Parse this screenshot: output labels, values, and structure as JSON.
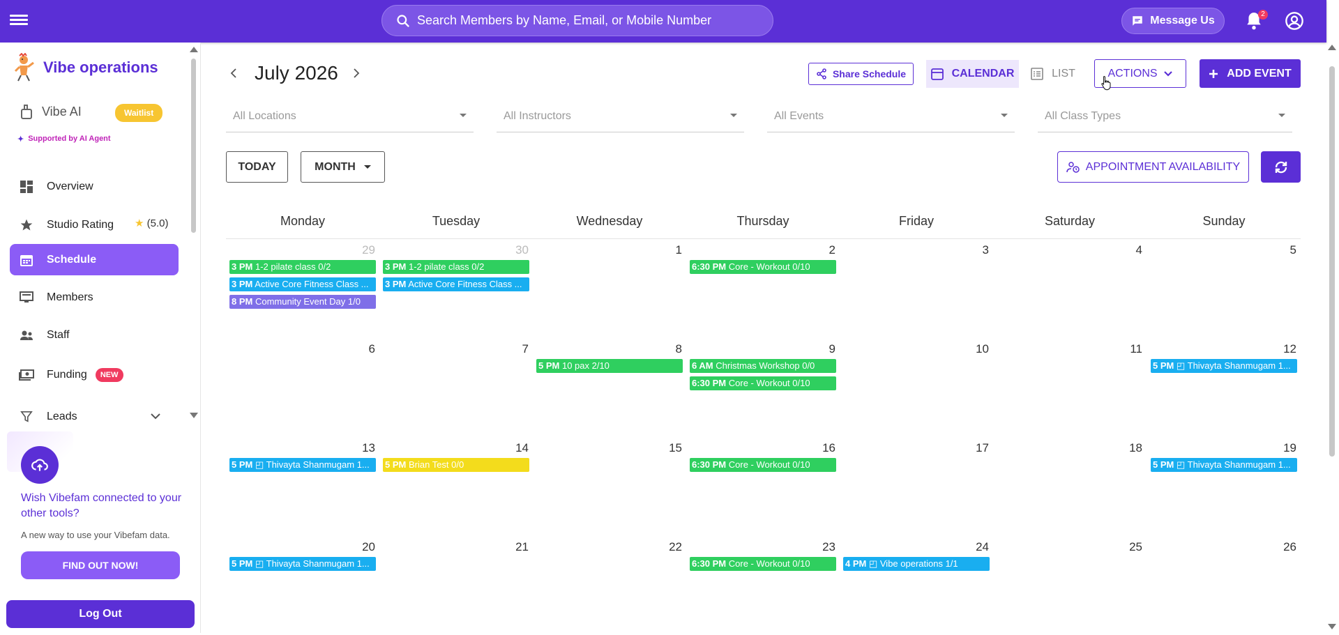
{
  "topbar": {
    "search_placeholder": "Search Members by Name, Email, or Mobile Number",
    "message_label": "Message Us",
    "notification_count": "2"
  },
  "sidebar": {
    "brand": "Vibe operations",
    "vibe_ai_label": "Vibe AI",
    "waitlist_badge": "Waitlist",
    "supported_text": "Supported by AI Agent",
    "items": [
      {
        "label": "Overview",
        "icon": "dashboard-icon"
      },
      {
        "label": "Studio Rating",
        "icon": "star-icon"
      },
      {
        "label": "Schedule",
        "icon": "calendar-icon",
        "active": true
      },
      {
        "label": "Members",
        "icon": "monitor-icon"
      },
      {
        "label": "Staff",
        "icon": "people-icon"
      },
      {
        "label": "Funding",
        "icon": "money-icon"
      },
      {
        "label": "Leads",
        "icon": "filter-icon"
      }
    ],
    "rating_value": "(5.0)",
    "rating_star": "★",
    "funding_badge": "NEW",
    "promo_title": "Wish Vibefam connected to your other tools?",
    "promo_subtitle": "A new way to use your Vibefam data.",
    "promo_button": "FIND OUT NOW!",
    "logout": "Log Out"
  },
  "header": {
    "month_title": "July 2026",
    "share_label": "Share Schedule",
    "calendar_label": "CALENDAR",
    "list_label": "LIST",
    "actions_label": "ACTIONS",
    "add_event_label": "ADD EVENT"
  },
  "filters": {
    "locations": "All Locations",
    "instructors": "All Instructors",
    "events": "All Events",
    "class_types": "All Class Types"
  },
  "controls": {
    "today": "TODAY",
    "month": "MONTH",
    "appointment": "APPOINTMENT AVAILABILITY"
  },
  "colors": {
    "brand": "#5b2fd6",
    "green": "#2fcf5f",
    "blue": "#19aef0",
    "purple": "#7f6fe8",
    "yellow": "#f3dc1c"
  },
  "calendar": {
    "weekdays": [
      "Monday",
      "Tuesday",
      "Wednesday",
      "Thursday",
      "Friday",
      "Saturday",
      "Sunday"
    ],
    "weeks": [
      [
        {
          "day": "29",
          "other": true,
          "events": [
            {
              "time": "3 PM",
              "title": "1-2 pilate class 0/2",
              "color": "green"
            },
            {
              "time": "3 PM",
              "title": "Active Core Fitness Class ...",
              "color": "blue"
            },
            {
              "time": "8 PM",
              "title": "Community Event Day 1/0",
              "color": "purple"
            }
          ]
        },
        {
          "day": "30",
          "other": true,
          "events": [
            {
              "time": "3 PM",
              "title": "1-2 pilate class 0/2",
              "color": "green"
            },
            {
              "time": "3 PM",
              "title": "Active Core Fitness Class ...",
              "color": "blue"
            }
          ]
        },
        {
          "day": "1",
          "events": []
        },
        {
          "day": "2",
          "events": [
            {
              "time": "6:30 PM",
              "title": "Core - Workout 0/10",
              "color": "green"
            }
          ]
        },
        {
          "day": "3",
          "events": []
        },
        {
          "day": "4",
          "events": []
        },
        {
          "day": "5",
          "events": []
        }
      ],
      [
        {
          "day": "6",
          "events": []
        },
        {
          "day": "7",
          "events": []
        },
        {
          "day": "8",
          "events": [
            {
              "time": "5 PM",
              "title": "10 pax 2/10",
              "color": "green"
            }
          ]
        },
        {
          "day": "9",
          "events": [
            {
              "time": "6 AM",
              "title": "Christmas Workshop 0/0",
              "color": "green"
            },
            {
              "time": "6:30 PM",
              "title": "Core - Workout 0/10",
              "color": "green"
            }
          ]
        },
        {
          "day": "10",
          "events": []
        },
        {
          "day": "11",
          "events": []
        },
        {
          "day": "12",
          "events": [
            {
              "time": "5 PM",
              "title": "◰ Thivayta Shanmugam 1...",
              "color": "blue"
            }
          ]
        }
      ],
      [
        {
          "day": "13",
          "events": [
            {
              "time": "5 PM",
              "title": "◰ Thivayta Shanmugam 1...",
              "color": "blue"
            }
          ]
        },
        {
          "day": "14",
          "events": [
            {
              "time": "5 PM",
              "title": "Brian Test 0/0",
              "color": "yellow"
            }
          ]
        },
        {
          "day": "15",
          "events": []
        },
        {
          "day": "16",
          "events": [
            {
              "time": "6:30 PM",
              "title": "Core - Workout 0/10",
              "color": "green"
            }
          ]
        },
        {
          "day": "17",
          "events": []
        },
        {
          "day": "18",
          "events": []
        },
        {
          "day": "19",
          "events": [
            {
              "time": "5 PM",
              "title": "◰ Thivayta Shanmugam 1...",
              "color": "blue"
            }
          ]
        }
      ],
      [
        {
          "day": "20",
          "events": [
            {
              "time": "5 PM",
              "title": "◰ Thivayta Shanmugam 1...",
              "color": "blue"
            }
          ]
        },
        {
          "day": "21",
          "events": []
        },
        {
          "day": "22",
          "events": []
        },
        {
          "day": "23",
          "events": [
            {
              "time": "6:30 PM",
              "title": "Core - Workout 0/10",
              "color": "green"
            }
          ]
        },
        {
          "day": "24",
          "events": [
            {
              "time": "4 PM",
              "title": "◰ Vibe operations 1/1",
              "color": "blue"
            }
          ]
        },
        {
          "day": "25",
          "events": []
        },
        {
          "day": "26",
          "events": []
        }
      ]
    ]
  }
}
